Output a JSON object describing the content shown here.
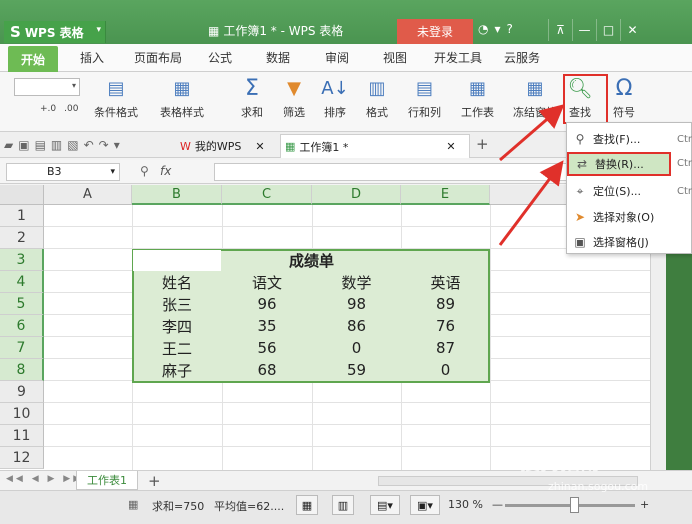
{
  "titlebar": {
    "app_name": "WPS 表格",
    "doc_title": "工作簿1 * - WPS 表格",
    "login": "未登录",
    "help": "?"
  },
  "tabs": [
    "开始",
    "插入",
    "页面布局",
    "公式",
    "数据",
    "审阅",
    "视图",
    "开发工具",
    "云服务"
  ],
  "ribbon": {
    "items": [
      "条件格式",
      "表格样式",
      "求和",
      "筛选",
      "排序",
      "格式",
      "行和列",
      "工作表",
      "冻结窗格",
      "查找",
      "符号"
    ]
  },
  "quickaccess": {
    "tab1": "我的WPS",
    "tab2": "工作簿1 *"
  },
  "formula_bar": {
    "cell_ref": "B3",
    "fx": "fx",
    "value": ""
  },
  "grid": {
    "columns": [
      "A",
      "B",
      "C",
      "D",
      "E"
    ],
    "rows": [
      "1",
      "2",
      "3",
      "4",
      "5",
      "6",
      "7",
      "8",
      "9",
      "10",
      "11",
      "12"
    ],
    "table_title": "成绩单",
    "headers": [
      "姓名",
      "语文",
      "数学",
      "英语"
    ],
    "data": [
      [
        "张三",
        "96",
        "98",
        "89"
      ],
      [
        "李四",
        "35",
        "86",
        "76"
      ],
      [
        "王二",
        "56",
        "0",
        "87"
      ],
      [
        "麻子",
        "68",
        "59",
        "0"
      ]
    ]
  },
  "find_menu": {
    "items": [
      {
        "label": "查找(F)...",
        "shortcut": "Ctr",
        "icon": "search-icon"
      },
      {
        "label": "替换(R)...",
        "shortcut": "Ctr",
        "icon": "replace-icon"
      },
      {
        "label": "定位(S)...",
        "shortcut": "Ctr",
        "icon": "locate-icon"
      },
      {
        "label": "选择对象(O)",
        "shortcut": "",
        "icon": "cursor-icon"
      },
      {
        "label": "选择窗格(J)",
        "shortcut": "",
        "icon": "pane-icon"
      }
    ]
  },
  "sheets": {
    "active": "工作表1",
    "add": "+"
  },
  "status": {
    "sum": "求和=750",
    "avg": "平均值=62....",
    "zoom": "130 %"
  },
  "watermark": {
    "brand": "搜狗指南",
    "url": "zhinan.sogou.com"
  },
  "colors": {
    "accent": "#5aa55f",
    "highlight": "#e0302a",
    "table_fill": "#dcecd4"
  }
}
